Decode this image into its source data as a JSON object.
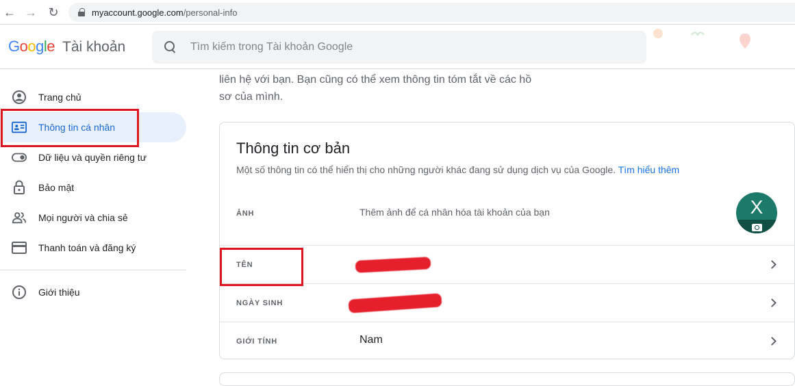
{
  "browser": {
    "url_host": "myaccount.google.com",
    "url_path": "/personal-info"
  },
  "header": {
    "logo_text": "Google",
    "product_name": "Tài khoản",
    "search_placeholder": "Tìm kiếm trong Tài khoản Google"
  },
  "sidebar": {
    "items": [
      {
        "label": "Trang chủ",
        "icon": "account-circle-icon"
      },
      {
        "label": "Thông tin cá nhân",
        "icon": "id-card-icon"
      },
      {
        "label": "Dữ liệu và quyền riêng tư",
        "icon": "toggle-icon"
      },
      {
        "label": "Bảo mật",
        "icon": "lock-icon"
      },
      {
        "label": "Mọi người và chia sẻ",
        "icon": "people-icon"
      },
      {
        "label": "Thanh toán và đăng ký",
        "icon": "credit-card-icon"
      }
    ],
    "about": {
      "label": "Giới thiệu",
      "icon": "info-icon"
    }
  },
  "main": {
    "intro_line1": "liên hệ với bạn. Bạn cũng có thể xem thông tin tóm tắt về các hồ",
    "intro_line2": "sơ của mình.",
    "card": {
      "title": "Thông tin cơ bản",
      "subtitle": "Một số thông tin có thể hiển thị cho những người khác đang sử dụng dịch vụ của Google.",
      "learn_more": "Tìm hiểu thêm",
      "rows": [
        {
          "label": "ẢNH",
          "value": "Thêm ảnh để cá nhân hóa tài khoản của bạn"
        },
        {
          "label": "TÊN",
          "value": ""
        },
        {
          "label": "NGÀY SINH",
          "value": ""
        },
        {
          "label": "GIỚI TÍNH",
          "value": "Nam"
        }
      ],
      "avatar_letter": "X"
    }
  },
  "colors": {
    "accent": "#1a73e8",
    "active_bg": "#e8f0fe",
    "highlight_red": "#e0141e",
    "avatar_bg": "#1b7a6a"
  }
}
